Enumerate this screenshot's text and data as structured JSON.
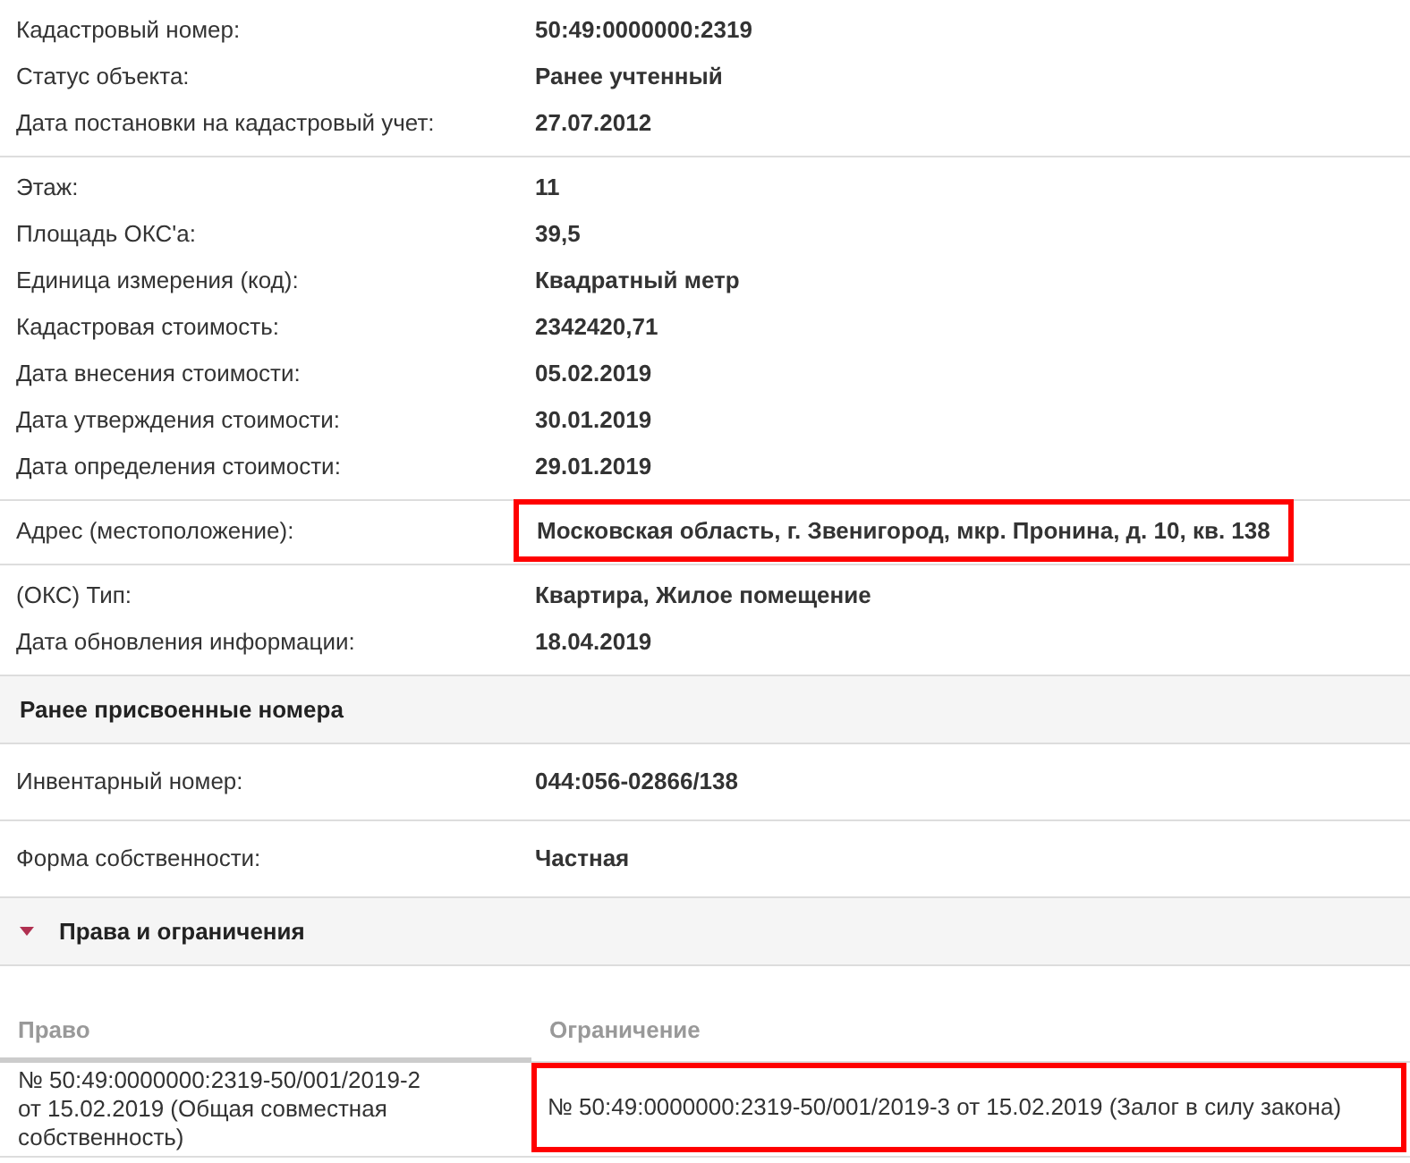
{
  "sections": [
    {
      "kind": "group",
      "rows": [
        {
          "label": "Кадастровый номер:",
          "value": "50:49:0000000:2319",
          "highlighted": false
        },
        {
          "label": "Статус объекта:",
          "value": "Ранее учтенный",
          "highlighted": false
        },
        {
          "label": "Дата постановки на кадастровый учет:",
          "value": "27.07.2012",
          "highlighted": false
        }
      ]
    },
    {
      "kind": "group",
      "rows": [
        {
          "label": "Этаж:",
          "value": "11",
          "highlighted": false
        },
        {
          "label": "Площадь ОКС'а:",
          "value": "39,5",
          "highlighted": false
        },
        {
          "label": "Единица измерения (код):",
          "value": "Квадратный метр",
          "highlighted": false
        },
        {
          "label": "Кадастровая стоимость:",
          "value": "2342420,71",
          "highlighted": false
        },
        {
          "label": "Дата внесения стоимости:",
          "value": "05.02.2019",
          "highlighted": false
        },
        {
          "label": "Дата утверждения стоимости:",
          "value": "30.01.2019",
          "highlighted": false
        },
        {
          "label": "Дата определения стоимости:",
          "value": "29.01.2019",
          "highlighted": false
        }
      ]
    },
    {
      "kind": "group",
      "rows": [
        {
          "label": "Адрес (местоположение):",
          "value": "Московская область, г. Звенигород, мкр. Пронина, д. 10, кв. 138",
          "highlighted": true
        }
      ]
    },
    {
      "kind": "group",
      "rows": [
        {
          "label": "(ОКС) Тип:",
          "value": "Квартира, Жилое помещение",
          "highlighted": false
        },
        {
          "label": "Дата обновления информации:",
          "value": "18.04.2019",
          "highlighted": false
        }
      ]
    },
    {
      "kind": "header",
      "title": "Ранее присвоенные номера"
    },
    {
      "kind": "single",
      "rows": [
        {
          "label": "Инвентарный номер:",
          "value": "044:056-02866/138",
          "highlighted": false
        }
      ]
    },
    {
      "kind": "single",
      "rows": [
        {
          "label": "Форма собственности:",
          "value": "Частная",
          "highlighted": false
        }
      ]
    },
    {
      "kind": "toggle",
      "title": "Права и ограничения",
      "expanded": true
    },
    {
      "kind": "table",
      "columns": [
        "Право",
        "Ограничение"
      ],
      "rows": [
        {
          "cells": [
            {
              "text": "№ 50:49:0000000:2319-50/001/2019-2\n от 15.02.2019  (Общая совместная собственность)",
              "highlighted": false
            },
            {
              "text": "№ 50:49:0000000:2319-50/001/2019-3  от 15.02.2019  (Залог в силу закона)",
              "highlighted": true
            }
          ]
        }
      ]
    }
  ]
}
